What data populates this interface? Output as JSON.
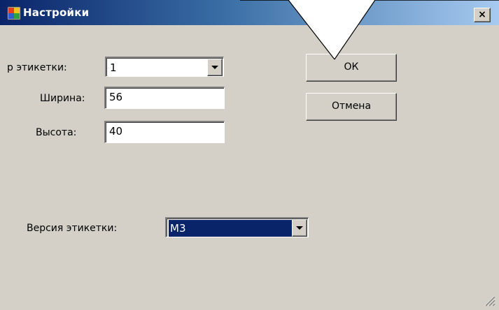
{
  "window": {
    "title": "Настройки",
    "close_label": "×"
  },
  "form": {
    "label_type": "р этикетки:",
    "label_type_value": "1",
    "width_label": "Ширина:",
    "width_value": "56",
    "height_label": "Высота:",
    "height_value": "40",
    "version_label": "Версия этикетки:",
    "version_value": "М3"
  },
  "buttons": {
    "ok": "ОК",
    "cancel": "Отмена"
  },
  "icons": {
    "app": "app-window-icon",
    "dropdown": "chevron-down-icon",
    "grip": "resize-grip-icon"
  },
  "colors": {
    "titlebar_start": "#0a246a",
    "titlebar_end": "#a6caf0",
    "dialog_bg": "#d4d0c8",
    "selection": "#0a246a"
  }
}
